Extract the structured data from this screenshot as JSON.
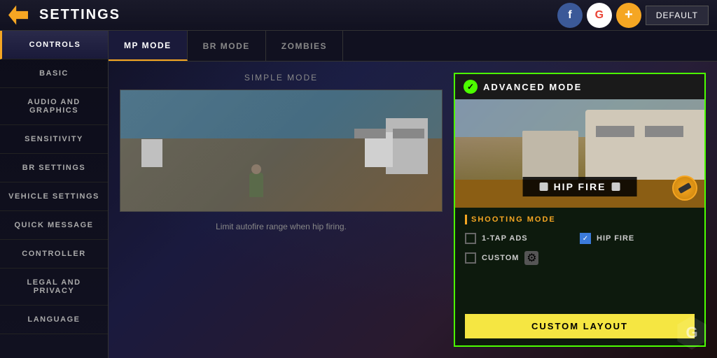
{
  "header": {
    "back_icon": "◄",
    "title": "SETTINGS",
    "social": {
      "facebook_label": "f",
      "google_label": "G",
      "plus_label": "+"
    },
    "default_btn": "DEFAULT"
  },
  "sidebar": {
    "items": [
      {
        "label": "CONTROLS",
        "active": true
      },
      {
        "label": "BASIC",
        "active": false
      },
      {
        "label": "AUDIO AND GRAPHICS",
        "active": false
      },
      {
        "label": "SENSITIVITY",
        "active": false
      },
      {
        "label": "BR SETTINGS",
        "active": false
      },
      {
        "label": "VEHICLE SETTINGS",
        "active": false
      },
      {
        "label": "QUICK MESSAGE",
        "active": false
      },
      {
        "label": "CONTROLLER",
        "active": false
      },
      {
        "label": "LEGAL AND PRIVACY",
        "active": false
      },
      {
        "label": "LANGUAGE",
        "active": false
      }
    ]
  },
  "tabs": [
    {
      "label": "MP MODE",
      "active": true
    },
    {
      "label": "BR MODE",
      "active": false
    },
    {
      "label": "ZOMBIES",
      "active": false
    }
  ],
  "simple_mode": {
    "title": "SIMPLE MODE",
    "description": "Limit autofire range when hip firing."
  },
  "advanced_mode": {
    "title": "ADVANCED MODE",
    "hip_fire_label": "HIP FIRE",
    "shooting_mode_title": "SHOOTING MODE",
    "options": [
      {
        "label": "1-tap ADS",
        "checked": false
      },
      {
        "label": "HIP FIRE",
        "checked": true
      },
      {
        "label": "CUSTOM",
        "checked": false
      }
    ],
    "custom_layout_btn": "CUSTOM LAYOUT"
  }
}
